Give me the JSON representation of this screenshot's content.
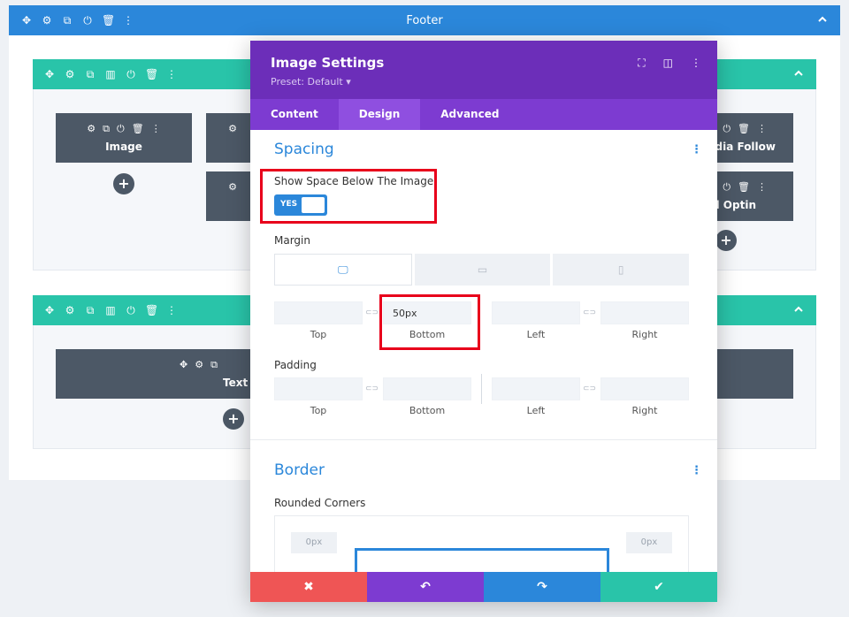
{
  "footer": {
    "title": "Footer"
  },
  "row1": {
    "modules": [
      {
        "label": "Image"
      },
      {
        "label": "edia Follow"
      },
      {
        "label": "il Optin"
      }
    ]
  },
  "row2": {
    "modules": [
      {
        "label": "Text"
      }
    ]
  },
  "modal": {
    "title": "Image Settings",
    "preset": "Preset: Default ▾",
    "tabs": [
      "Content",
      "Design",
      "Advanced"
    ],
    "active_tab": "Design",
    "spacing": {
      "title": "Spacing",
      "show_space_label": "Show Space Below The Image",
      "toggle_value": "YES",
      "margin_label": "Margin",
      "margin_bottom_value": "50px",
      "padding_label": "Padding",
      "sides": {
        "top": "Top",
        "bottom": "Bottom",
        "left": "Left",
        "right": "Right"
      }
    },
    "border": {
      "title": "Border",
      "rounded_label": "Rounded Corners",
      "corner_tl": "0px",
      "corner_tr": "0px"
    }
  },
  "colors": {
    "section_blue": "#2b87da",
    "row_teal": "#29c4a9",
    "modal_purple": "#6c2eb9",
    "cancel_red": "#ef5555",
    "undo_purple": "#7d3bd1",
    "redo_blue": "#2b87da",
    "save_teal": "#29c4a9",
    "highlight_red": "#e8001b"
  }
}
